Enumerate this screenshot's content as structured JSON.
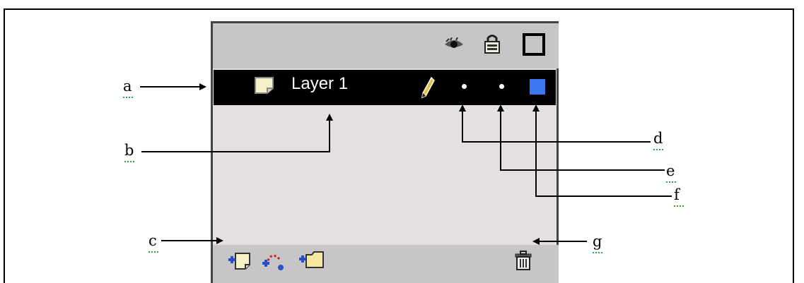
{
  "panel": {
    "layer_name": "Layer 1",
    "selected_color": "#3a78f0",
    "header_icons": [
      "eye-icon",
      "lock-icon",
      "outline-icon"
    ],
    "row_icons": [
      "layer-icon",
      "pencil-icon",
      "dot-icon",
      "dot-icon",
      "color-square"
    ],
    "footer_icons": [
      "insert-layer-icon",
      "add-motion-guide-icon",
      "insert-folder-icon",
      "trash-icon"
    ]
  },
  "labels": {
    "a": "a",
    "b": "b",
    "c": "c",
    "d": "d",
    "e": "e",
    "f": "f",
    "g": "g"
  }
}
